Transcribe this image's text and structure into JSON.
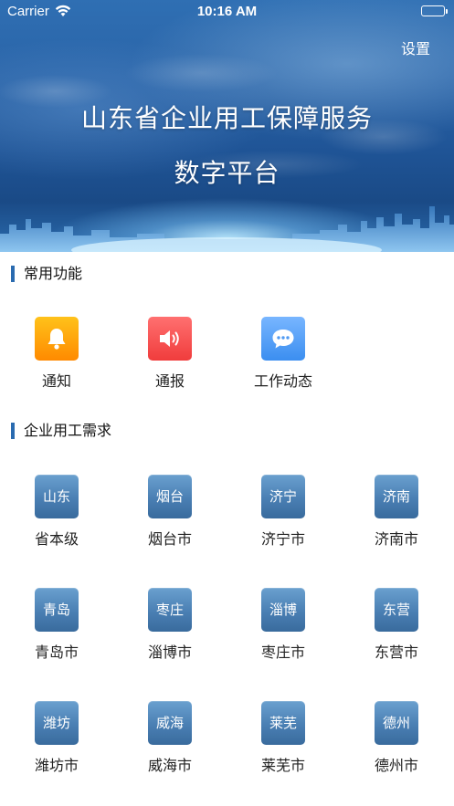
{
  "status_bar": {
    "carrier": "Carrier",
    "time": "10:16 AM"
  },
  "header": {
    "settings_label": "设置",
    "title_line1": "山东省企业用工保障服务",
    "title_line2": "数字平台"
  },
  "sections": {
    "common": "常用功能",
    "demand": "企业用工需求"
  },
  "functions": [
    {
      "label": "通知",
      "icon": "bell-icon",
      "color": "#ffa20a"
    },
    {
      "label": "通报",
      "icon": "speaker-icon",
      "color": "#f25050"
    },
    {
      "label": "工作动态",
      "icon": "chat-bubble-icon",
      "color": "#4f9af3"
    }
  ],
  "cities": [
    {
      "short": "山东",
      "label": "省本级"
    },
    {
      "short": "烟台",
      "label": "烟台市"
    },
    {
      "short": "济宁",
      "label": "济宁市"
    },
    {
      "short": "济南",
      "label": "济南市"
    },
    {
      "short": "青岛",
      "label": "青岛市"
    },
    {
      "short": "枣庄",
      "label": "淄博市"
    },
    {
      "short": "淄博",
      "label": "枣庄市"
    },
    {
      "short": "东营",
      "label": "东营市"
    },
    {
      "short": "潍坊",
      "label": "潍坊市"
    },
    {
      "short": "威海",
      "label": "威海市"
    },
    {
      "short": "莱芜",
      "label": "莱芜市"
    },
    {
      "short": "德州",
      "label": "德州市"
    }
  ],
  "colors": {
    "accent": "#2a6bb0",
    "city_tile": "#4a7fb3"
  }
}
